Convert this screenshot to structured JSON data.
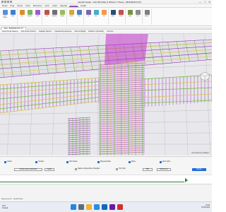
{
  "window": {
    "title": "ideCAD Statik - C40 4B Paftaı (1 Bölüm) T Plansı - [BODRUM KAT]",
    "controls": [
      "—",
      "□",
      "✕"
    ]
  },
  "ribbon_tabs": [
    {
      "label": "Dosya",
      "active": false
    },
    {
      "label": "Proje",
      "active": false
    },
    {
      "label": "Mimari",
      "active": false
    },
    {
      "label": "Kolon",
      "active": false
    },
    {
      "label": "Betonarme",
      "active": false
    },
    {
      "label": "Çizim",
      "active": false
    },
    {
      "label": "Analiz",
      "active": false
    },
    {
      "label": "Raporlar",
      "active": false
    },
    {
      "label": "Görünüm",
      "active": true
    },
    {
      "label": "Araçlar",
      "active": false
    }
  ],
  "ribbon_groups": [
    {
      "buttons": [
        {
          "label": "Çizim Yöntemi",
          "icon": "grid-icon",
          "color": "#5b8fd6"
        },
        {
          "label": "Kolon",
          "icon": "column-icon",
          "color": "#3f7fcf"
        }
      ]
    },
    {
      "buttons": [
        {
          "label": "Kiriş",
          "icon": "beam-icon",
          "color": "#e0892b"
        },
        {
          "label": "Döşeme",
          "icon": "slab-icon",
          "color": "#7bb661"
        },
        {
          "label": "Perde",
          "icon": "wall-icon",
          "color": "#a05ad6"
        }
      ]
    },
    {
      "buttons": [
        {
          "label": "Temel",
          "icon": "foundation-icon",
          "color": "#c0504d"
        },
        {
          "label": "Merdiven",
          "icon": "stair-icon",
          "color": "#6f6f6f"
        },
        {
          "label": "Rampa",
          "icon": "ramp-icon",
          "color": "#9bbb59"
        }
      ]
    },
    {
      "buttons": [
        {
          "label": "Donatı",
          "icon": "rebar-icon",
          "color": "#d6a63a"
        },
        {
          "label": "Kesit",
          "icon": "section-icon",
          "color": "#4f81bd"
        }
      ]
    },
    {
      "buttons": [
        {
          "label": "Kat",
          "icon": "floor-icon",
          "color": "#8064a2"
        },
        {
          "label": "Aks",
          "icon": "axis-icon",
          "color": "#4bacc6"
        },
        {
          "label": "Ölçü",
          "icon": "dimension-icon",
          "color": "#f79646"
        }
      ]
    },
    {
      "buttons": [
        {
          "label": "Analiz",
          "icon": "analysis-icon",
          "color": "#2c4d75"
        },
        {
          "label": "Tasarım",
          "icon": "design-icon",
          "color": "#c0504d"
        }
      ]
    },
    {
      "buttons": [
        {
          "label": "Rapor",
          "icon": "report-icon",
          "color": "#77933c"
        },
        {
          "label": "Çıktı",
          "icon": "print-icon",
          "color": "#8c8c8c"
        }
      ]
    },
    {
      "buttons": [
        {
          "label": "Ayarlar",
          "icon": "gear-icon",
          "color": "#7f7f7f"
        }
      ]
    }
  ],
  "doc_tab": {
    "label": "Plan - BODRUM KAT, FT"
  },
  "view_tabs": [
    {
      "label": "Kolon Donatı Tasarımı",
      "active": false
    },
    {
      "label": "Kiriş Donatı Tasarımı",
      "active": false
    },
    {
      "label": "Kapaklar Tasarımı",
      "active": false
    },
    {
      "label": "Kapaklar Boyutandırma",
      "active": false
    },
    {
      "label": "Moment Eğriliği",
      "active": false
    },
    {
      "label": "Betibrka 1 (Donatılar)",
      "active": false
    },
    {
      "label": "Görünüm",
      "active": true
    }
  ],
  "viewport": {
    "hint": "Yeni seçim için tıklayın",
    "colors": {
      "background": "#e8e8ec",
      "rebar_green": "#6bbf2f",
      "rebar_yellow": "#d9c43a",
      "rebar_purple": "#9b2fb3",
      "rebar_magenta": "#c234c9",
      "ghost_lines": "#9c9ca6"
    },
    "nav_cube": "view-cube-icon"
  },
  "options": {
    "checks": [
      {
        "label": "Göster",
        "checked": true
      },
      {
        "label": "Yerleşik",
        "checked": true
      },
      {
        "label": "Gizli donatı",
        "checked": true
      },
      {
        "label": "Boyuna donatı",
        "checked": true
      },
      {
        "label": "Etriye",
        "checked": true
      },
      {
        "label": "Çiroz çizim",
        "checked": true
      }
    ],
    "buttons": {
      "draw_all": "Donatı Çizimi Görüntüle",
      "close": "Kapat",
      "settings": "Bitir",
      "refresh": "Belirlenmiş",
      "apply": "Tamam"
    },
    "check2": {
      "label": "Tüm Kiriş",
      "checked": false
    },
    "check3": {
      "label": "Sadece Güçlendirme Parçaları",
      "checked": false
    }
  },
  "status_strip": {
    "progress": 0.87,
    "color": "#2e7d32"
  },
  "status_bar": {
    "text": "Bodrum Kat FT - ideCAD Statik"
  },
  "taskbar": {
    "weather_temp": "20°C",
    "weather_text": "Güneşli",
    "apps": [
      {
        "icon": "windows-icon",
        "color": "#1e88e5"
      },
      {
        "icon": "search-icon",
        "color": "#5f6b7a"
      },
      {
        "icon": "folder-icon",
        "color": "#f2b233"
      },
      {
        "icon": "browser-icon",
        "color": "#2a8fde"
      },
      {
        "icon": "mail-icon",
        "color": "#1565c0"
      },
      {
        "icon": "idecad-icon",
        "color": "#6a1b9a"
      },
      {
        "icon": "pdf-icon",
        "color": "#d32f2f"
      }
    ],
    "time": "16:32",
    "date": "15.05.2024"
  }
}
